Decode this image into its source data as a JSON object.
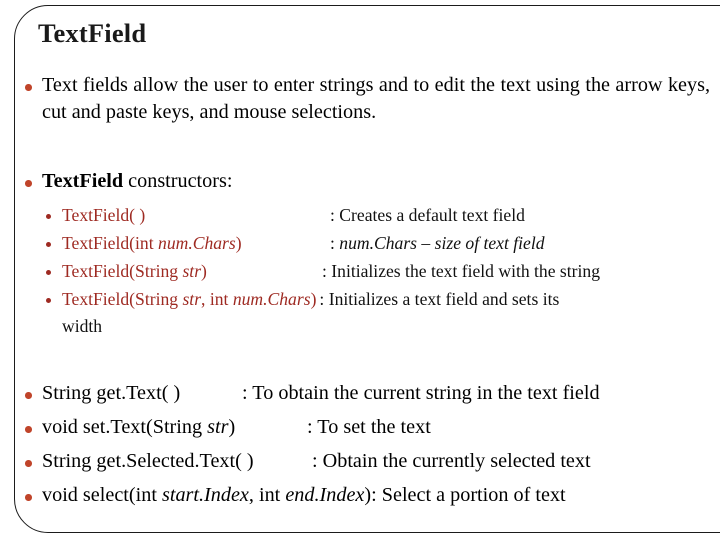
{
  "slide": {
    "title": "TextField",
    "bullet_color": "#c0442a",
    "subbullet_color": "#9e2a22",
    "signature_color": "#9e2a22",
    "text_color": "#000000"
  },
  "intro": {
    "text": "Text fields allow the user to enter strings and to edit the text using the arrow keys, cut and paste keys, and mouse selections."
  },
  "constructors_heading": {
    "bold_part": "TextField",
    "rest": " constructors:"
  },
  "constructors": [
    {
      "sig_pre": "TextField( )",
      "sig_italic": "",
      "sig_post": "",
      "desc_pre": ": Creates a default text field",
      "desc_italic": "",
      "desc_post": "",
      "desc_italic_all": false
    },
    {
      "sig_pre": "TextField(int ",
      "sig_italic": "num.Chars",
      "sig_post": ")",
      "desc_pre": ": ",
      "desc_italic": "num.Chars – size of text field",
      "desc_post": "",
      "desc_italic_all": true
    },
    {
      "sig_pre": "TextField(String ",
      "sig_italic": "str",
      "sig_post": ")",
      "desc_pre": ": Initializes the text field with the string",
      "desc_italic": "",
      "desc_post": "",
      "desc_italic_all": false
    },
    {
      "sig_pre": "TextField(String ",
      "sig_italic": "str",
      "sig_mid": ", int ",
      "sig_italic2": "num.Chars",
      "sig_post": ")",
      "desc_pre": ": Initializes a text field and sets its",
      "desc_italic": "",
      "desc_post": "",
      "desc_italic_all": false
    }
  ],
  "constructor_wrap_line": "width",
  "methods": [
    {
      "sig_pre": "String get.Text( )",
      "sig_italic": "",
      "sig_mid": "",
      "sig_italic2": "",
      "sig_post": "",
      "desc": ": To obtain the current string in the text field"
    },
    {
      "sig_pre": "void set.Text(String ",
      "sig_italic": "str",
      "sig_mid": "",
      "sig_italic2": "",
      "sig_post": ")",
      "desc": ": To set the text"
    },
    {
      "sig_pre": "String get.Selected.Text( )",
      "sig_italic": "",
      "sig_mid": "",
      "sig_italic2": "",
      "sig_post": "",
      "desc": ": Obtain the currently selected text"
    },
    {
      "sig_pre": "void select(int ",
      "sig_italic": "start.Index",
      "sig_mid": ", int ",
      "sig_italic2": "end.Index",
      "sig_post": ")",
      "desc": ": Select a portion of text"
    }
  ]
}
